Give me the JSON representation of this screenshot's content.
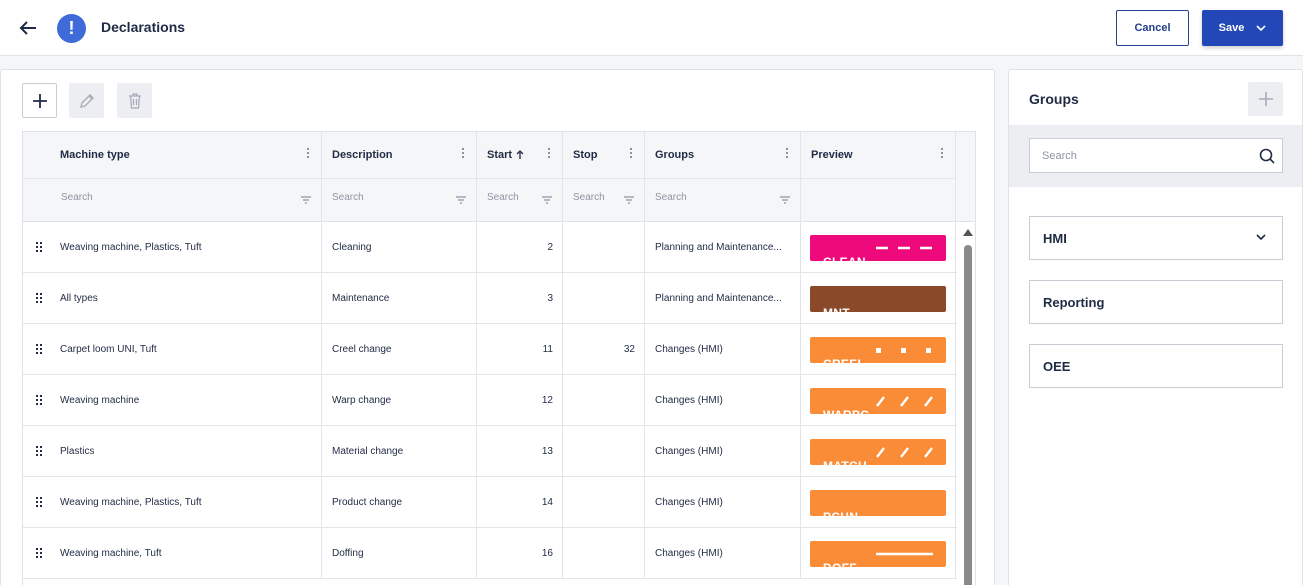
{
  "header": {
    "title": "Declarations",
    "alert_glyph": "!",
    "cancel_label": "Cancel",
    "save_label": "Save"
  },
  "colors": {
    "primary": "#2447b8",
    "clean": "#ef0a7c",
    "mnt": "#8a4a2a",
    "orange": "#fa8c38"
  },
  "table": {
    "columns": [
      {
        "label": "Machine type"
      },
      {
        "label": "Description"
      },
      {
        "label": "Start",
        "sort": "asc"
      },
      {
        "label": "Stop"
      },
      {
        "label": "Groups"
      },
      {
        "label": "Preview"
      }
    ],
    "filter_placeholder": "Search",
    "rows": [
      {
        "machine": "Weaving machine, Plastics, Tuft",
        "description": "Cleaning",
        "start": "2",
        "stop": "",
        "groups": "Planning and Maintenance...",
        "code": "CLEAN",
        "color": "#ef0a7c",
        "pattern": "dash"
      },
      {
        "machine": "All types",
        "description": "Maintenance",
        "start": "3",
        "stop": "",
        "groups": "Planning and Maintenance...",
        "code": "MNT",
        "color": "#8a4a2a",
        "pattern": "none"
      },
      {
        "machine": "Carpet loom UNI, Tuft",
        "description": "Creel change",
        "start": "11",
        "stop": "32",
        "groups": "Changes (HMI)",
        "code": "CREEL",
        "color": "#fa8c38",
        "pattern": "dot"
      },
      {
        "machine": "Weaving machine",
        "description": "Warp change",
        "start": "12",
        "stop": "",
        "groups": "Changes (HMI)",
        "code": "WARPC",
        "color": "#fa8c38",
        "pattern": "slash"
      },
      {
        "machine": "Plastics",
        "description": "Material change",
        "start": "13",
        "stop": "",
        "groups": "Changes (HMI)",
        "code": "MATCH",
        "color": "#fa8c38",
        "pattern": "slash"
      },
      {
        "machine": "Weaving machine, Plastics, Tuft",
        "description": "Product change",
        "start": "14",
        "stop": "",
        "groups": "Changes (HMI)",
        "code": "PCHN",
        "color": "#fa8c38",
        "pattern": "none"
      },
      {
        "machine": "Weaving machine, Tuft",
        "description": "Doffing",
        "start": "16",
        "stop": "",
        "groups": "Changes (HMI)",
        "code": "DOFF",
        "color": "#fa8c38",
        "pattern": "line"
      }
    ]
  },
  "groups": {
    "title": "Groups",
    "search_placeholder": "Search",
    "items": [
      {
        "label": "HMI",
        "expandable": true
      },
      {
        "label": "Reporting",
        "expandable": false
      },
      {
        "label": "OEE",
        "expandable": false
      }
    ]
  },
  "icons": {
    "back": "arrow-left-icon",
    "add": "plus-icon",
    "edit": "pencil-icon",
    "delete": "trash-icon",
    "menu": "kebab-icon",
    "filter": "filter-icon",
    "search": "magnifier-icon",
    "expand": "chevron-down-icon",
    "drag": "drag-handle-icon"
  }
}
